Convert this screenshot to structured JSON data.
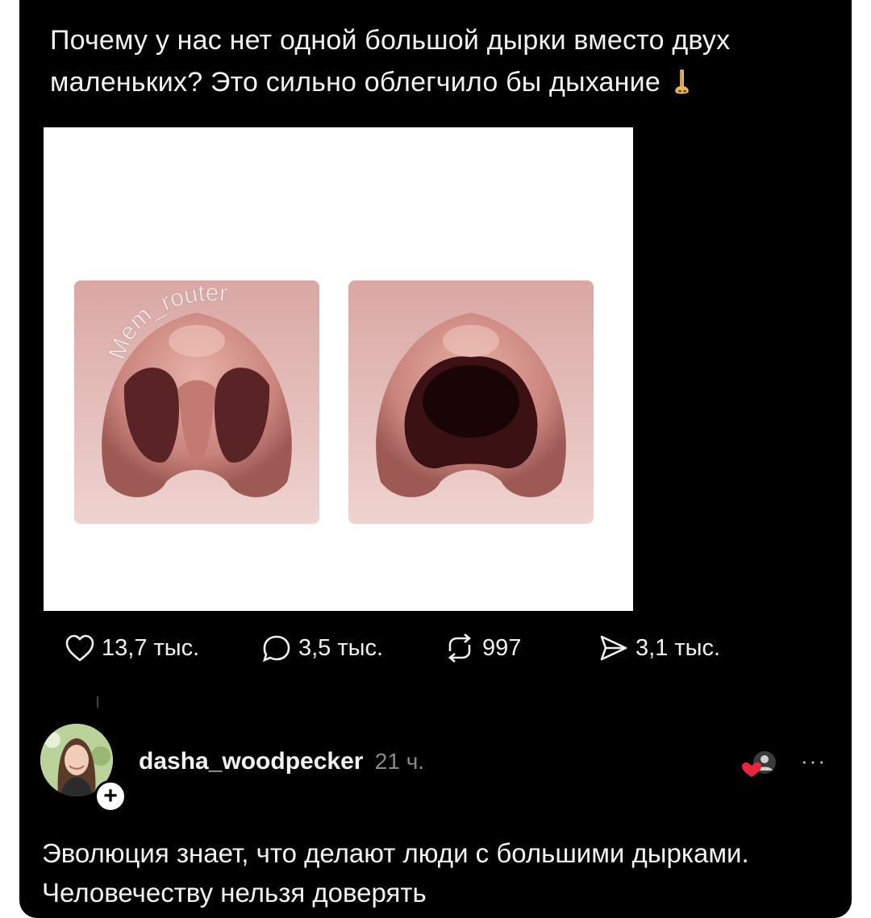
{
  "post": {
    "text": "Почему у нас нет одной большой дырки вместо двух маленьких? Это сильно облегчило бы дыхание",
    "emoji_icon": "nose-icon",
    "watermark": "Mem_router"
  },
  "actions": {
    "likes": "13,7 тыс.",
    "comments": "3,5 тыс.",
    "reposts": "997",
    "shares": "3,1 тыс."
  },
  "comment": {
    "username": "dasha_woodpecker",
    "time": "21 ч.",
    "text": "Эволюция знает, что делают люди с большими дырками. Человечеству нельзя доверять",
    "add_label": "+",
    "more_label": "···"
  },
  "colors": {
    "background": "#000000",
    "text": "#f2f2f2",
    "muted": "#8a8a8a",
    "like_heart": "#e8253f"
  }
}
